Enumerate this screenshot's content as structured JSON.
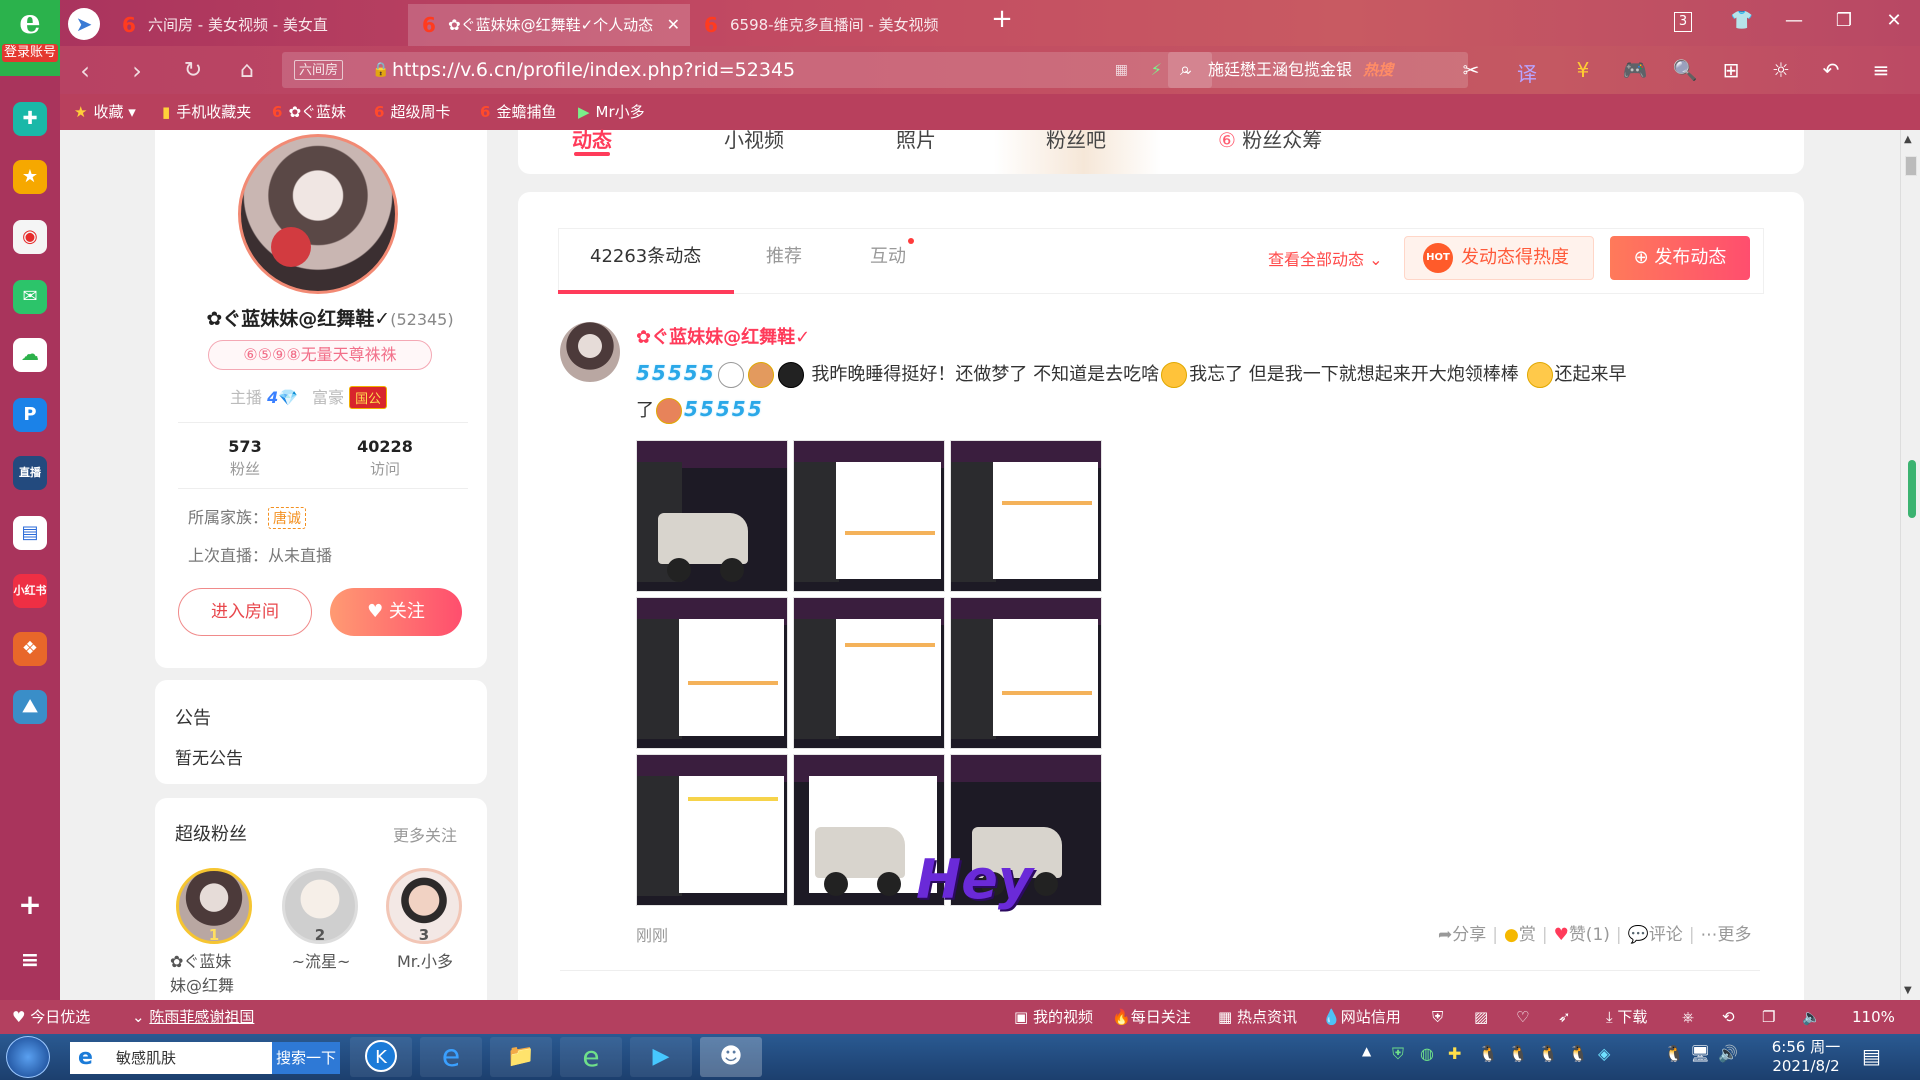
{
  "browser": {
    "login_label": "登录账号",
    "tabs": [
      {
        "label": "六间房 - 美女视频 - 美女直播",
        "active": false
      },
      {
        "label": "✿ぐ蓝妹妹@红舞鞋✓个人动态",
        "active": true
      },
      {
        "label": "6598-维克多直播间 - 美女视频",
        "active": false
      }
    ],
    "tab_count": "3",
    "url_site_tag": "六间房",
    "url": "https://v.6.cn/profile/index.php?rid=52345",
    "search_text": "施廷懋王涵包揽金银",
    "search_hot": "热搜",
    "bookmarks": [
      "收藏",
      "手机收藏夹",
      "✿ぐ蓝妹",
      "超级周卡",
      "金蟾捕鱼",
      "Mr小多"
    ]
  },
  "left_sidebar_icons": [
    "add-icon-green",
    "star-icon",
    "weibo-icon",
    "mail-icon",
    "cloud-icon",
    "p-icon",
    "game-icon",
    "doc-icon",
    "xiaohongshu-icon",
    "puzzle-icon",
    "landscape-icon",
    "plus-icon",
    "menu-icon"
  ],
  "profile": {
    "name": "✿ぐ蓝妹妹@红舞鞋✓",
    "rid": "(52345)",
    "badge": "⑥⑤⑨⑧无量天尊祩祩",
    "anchor_label": "主播",
    "anchor_level": "4",
    "rich_label": "富豪",
    "rich_tag": "国公",
    "fans_count": "573",
    "fans_label": "粉丝",
    "visits_count": "40228",
    "visits_label": "访问",
    "family_label": "所属家族：",
    "family_value": "唐诚",
    "last_live": "上次直播：从未直播",
    "enter_room": "进入房间",
    "follow": "关注"
  },
  "notice": {
    "title": "公告",
    "content": "暂无公告"
  },
  "super_fans": {
    "title": "超级粉丝",
    "more": "更多关注",
    "fans": [
      {
        "rank": "1",
        "name": "✿ぐ蓝妹妹@红舞"
      },
      {
        "rank": "2",
        "name": "~流星~"
      },
      {
        "rank": "3",
        "name": "Mr.小多"
      }
    ]
  },
  "top_tabs": [
    "动态",
    "小视频",
    "照片",
    "粉丝吧",
    "粉丝众筹"
  ],
  "feed": {
    "tabs": [
      "42263条动态",
      "推荐",
      "互动"
    ],
    "view_all": "查看全部动态",
    "hot_button": "发动态得热度",
    "hot_badge": "HOT",
    "publish_button": "发布动态",
    "post": {
      "author": "✿ぐ蓝妹妹@红舞鞋✓",
      "text_1": "我昨晚睡得挺好！还做梦了 不知道是去吃啥",
      "text_2": "我忘了 但是我一下就想起来开大炮领棒棒",
      "text_3": "还起来早",
      "text_4": "了",
      "image_caption": "Hey",
      "time": "刚刚",
      "share": "分享",
      "reward": "赏",
      "like": "赞(1)",
      "comment": "评论",
      "more": "更多"
    }
  },
  "statusbar": {
    "left_1": "今日优选",
    "left_2": "陈雨菲感谢祖国",
    "items": [
      "我的视频",
      "每日关注",
      "热点资讯",
      "网站信用",
      "下载"
    ],
    "zoom": "110%"
  },
  "taskbar": {
    "search_placeholder": "敏感肌肤",
    "search_button": "搜索一下",
    "time": "6:56 周一",
    "date": "2021/8/2"
  }
}
